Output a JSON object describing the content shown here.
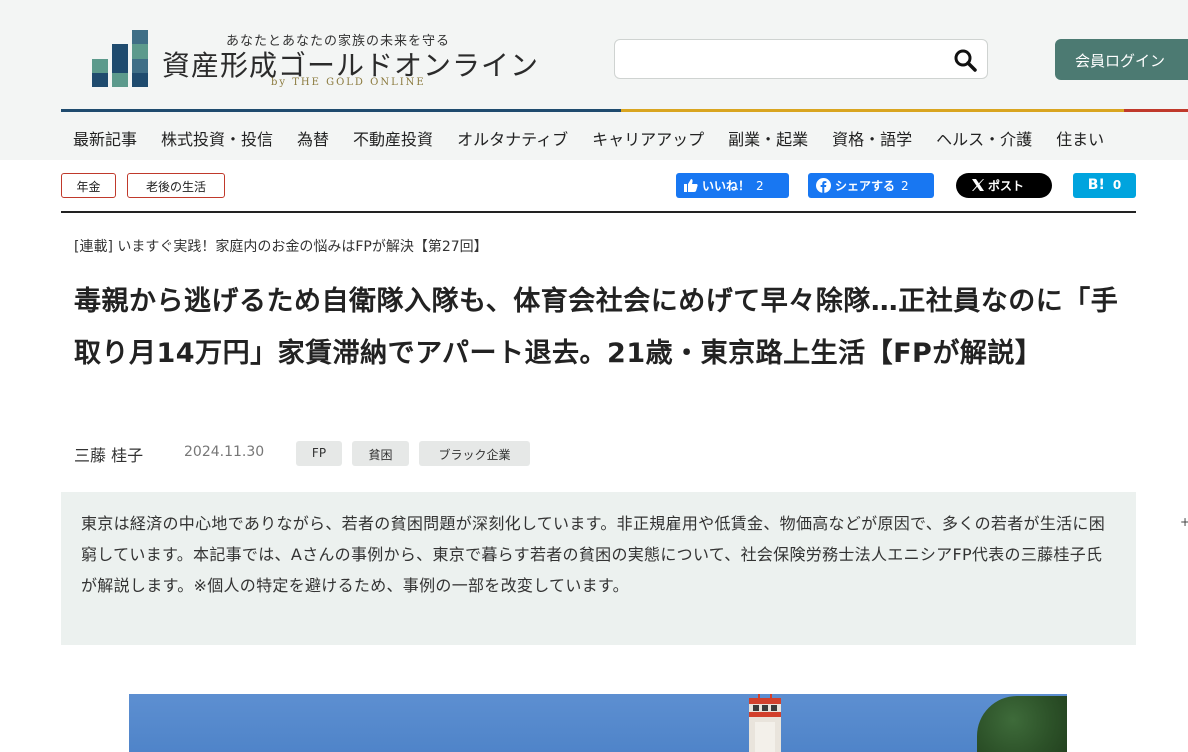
{
  "site": {
    "tagline": "あなたとあなたの家族の未来を守る",
    "name": "資産形成ゴールドオンライン",
    "sub": "by THE GOLD ONLINE",
    "login_label": "会員ログイン",
    "search_placeholder": ""
  },
  "colors": {
    "accent_green": "#4c7a72",
    "tag_border": "#c0392b",
    "facebook": "#1877f2",
    "x": "#000000",
    "hatena": "#00a4de",
    "bar_segments": [
      "#1f4b6e",
      "#d9a520",
      "#c0392b"
    ]
  },
  "nav": {
    "items": [
      "最新記事",
      "株式投資・投信",
      "為替",
      "不動産投資",
      "オルタナティブ",
      "キャリアアップ",
      "副業・起業",
      "資格・語学",
      "ヘルス・介護",
      "住まい"
    ]
  },
  "tags": [
    "年金",
    "老後の生活"
  ],
  "share": {
    "like_label": "いいね！",
    "like_count": "2",
    "fb_label": "シェアする",
    "fb_count": "2",
    "x_label": "ポスト",
    "hatena_label": "B!",
    "hatena_count": "0"
  },
  "article": {
    "series": "[連載] いますぐ実践！家庭内のお金の悩みはFPが解決【第27回】",
    "title": "毒親から逃げるため自衛隊入隊も、体育会社会にめげて早々除隊…正社員なのに「手取り月14万円」家賃滞納でアパート退去。21歳・東京路上生活【FPが解説】",
    "author": "三藤 桂子",
    "date": "2024.11.30",
    "keywords": [
      "FP",
      "貧困",
      "ブラック企業"
    ],
    "summary": "東京は経済の中心地でありながら、若者の貧困問題が深刻化しています。非正規雇用や低賃金、物価高などが原因で、多くの若者が生活に困窮しています。本記事では、Aさんの事例から、東京で暮らす若者の貧困の実態について、社会保険労務士法人エニシアFP代表の三藤桂子氏が解説します。※個人の特定を避けるため、事例の一部を改変しています。"
  },
  "icons": {
    "search": "search-icon",
    "like": "thumbs-up-icon",
    "facebook": "facebook-icon",
    "x": "x-logo-icon"
  }
}
